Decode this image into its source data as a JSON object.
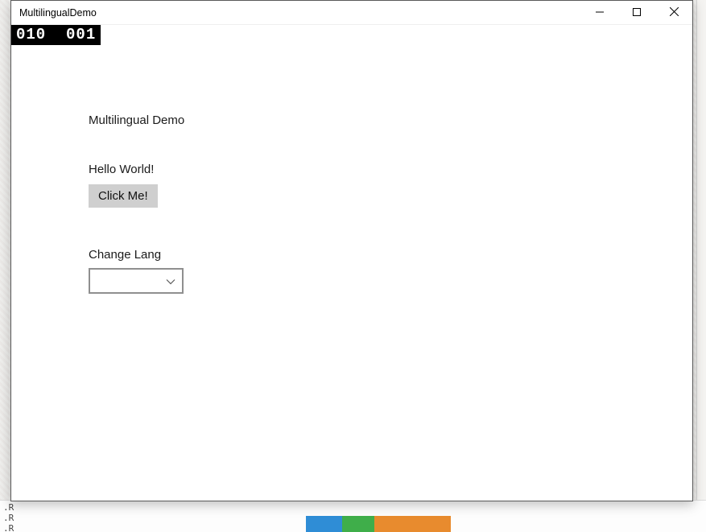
{
  "window": {
    "title": "MultilingualDemo"
  },
  "debug": {
    "counter": "010  001"
  },
  "content": {
    "heading": "Multilingual Demo",
    "greeting": "Hello World!",
    "button_label": "Click Me!",
    "change_lang_label": "Change Lang",
    "combo_value": ""
  },
  "background": {
    "output_text": ".R\n.R\n.R"
  }
}
